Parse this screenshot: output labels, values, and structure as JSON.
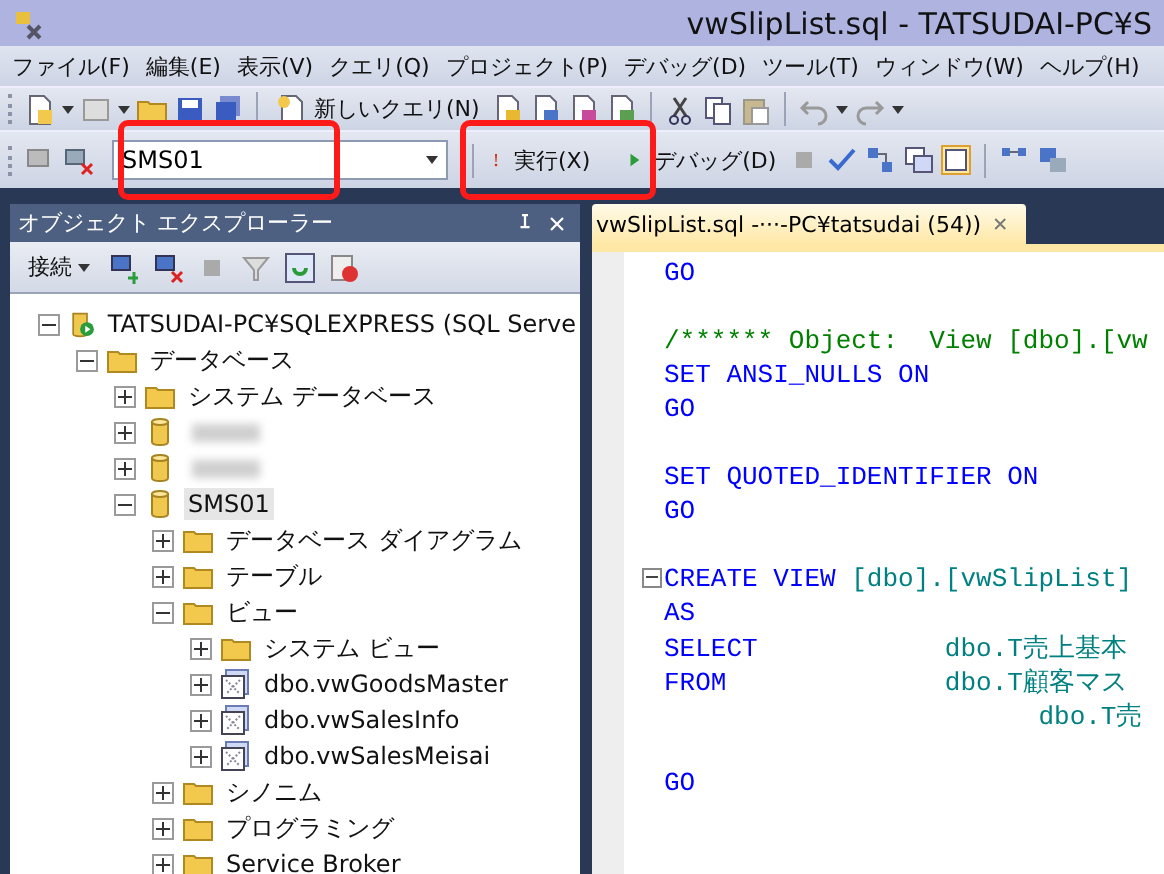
{
  "window": {
    "title": "vwSlipList.sql - TATSUDAI-PC¥S"
  },
  "menu": [
    "ファイル(F)",
    "編集(E)",
    "表示(V)",
    "クエリ(Q)",
    "プロジェクト(P)",
    "デバッグ(D)",
    "ツール(T)",
    "ウィンドウ(W)",
    "ヘルプ(H)"
  ],
  "toolbar": {
    "new_query": "新しいクエリ(N)",
    "database_combo": "SMS01",
    "execute": "実行(X)",
    "debug": "デバッグ(D)"
  },
  "object_explorer": {
    "title": "オブジェクト エクスプローラー",
    "connect": "接続",
    "tree": [
      {
        "kind": "server",
        "label": "TATSUDAI-PC¥SQLEXPRESS (SQL Serve",
        "expanded": true,
        "children": [
          {
            "kind": "folder",
            "label": "データベース",
            "expanded": true,
            "children": [
              {
                "kind": "folder",
                "label": "システム データベース",
                "expanded": false
              },
              {
                "kind": "database",
                "blurred": true,
                "expanded": false
              },
              {
                "kind": "database",
                "blurred": true,
                "expanded": false
              },
              {
                "kind": "database",
                "label": "SMS01",
                "expanded": true,
                "selected": true,
                "children": [
                  {
                    "kind": "folder",
                    "label": "データベース ダイアグラム",
                    "expanded": false
                  },
                  {
                    "kind": "folder",
                    "label": "テーブル",
                    "expanded": false
                  },
                  {
                    "kind": "folder",
                    "label": "ビュー",
                    "expanded": true,
                    "children": [
                      {
                        "kind": "folder",
                        "label": "システム ビュー",
                        "expanded": false
                      },
                      {
                        "kind": "view",
                        "label": "dbo.vwGoodsMaster",
                        "expanded": false
                      },
                      {
                        "kind": "view",
                        "label": "dbo.vwSalesInfo",
                        "expanded": false
                      },
                      {
                        "kind": "view",
                        "label": "dbo.vwSalesMeisai",
                        "expanded": false
                      }
                    ]
                  },
                  {
                    "kind": "folder",
                    "label": "シノニム",
                    "expanded": false
                  },
                  {
                    "kind": "folder",
                    "label": "プログラミング",
                    "expanded": false
                  },
                  {
                    "kind": "folder",
                    "label": "Service Broker",
                    "expanded": false
                  }
                ]
              }
            ]
          }
        ]
      }
    ]
  },
  "editor": {
    "tab": "vwSlipList.sql -···-PC¥tatsudai (54))",
    "lines": [
      {
        "space_before": false,
        "foldable": false,
        "segments": [
          {
            "kind": "keyword",
            "text": "GO"
          }
        ]
      },
      {
        "space_before": true,
        "foldable": false,
        "segments": [
          {
            "kind": "comment",
            "text": "/****** Object:  View [dbo].[vw"
          }
        ]
      },
      {
        "space_before": false,
        "foldable": false,
        "segments": [
          {
            "kind": "keyword",
            "text": "SET ANSI_NULLS ON"
          }
        ]
      },
      {
        "space_before": false,
        "foldable": false,
        "segments": [
          {
            "kind": "keyword",
            "text": "GO"
          }
        ]
      },
      {
        "space_before": true,
        "foldable": false,
        "segments": [
          {
            "kind": "keyword",
            "text": "SET QUOTED_IDENTIFIER ON"
          }
        ]
      },
      {
        "space_before": false,
        "foldable": false,
        "segments": [
          {
            "kind": "keyword",
            "text": "GO"
          }
        ]
      },
      {
        "space_before": true,
        "foldable": true,
        "segments": [
          {
            "kind": "keyword",
            "text": "CREATE VIEW "
          },
          {
            "kind": "identifier",
            "text": "[dbo].[vwSlipList]"
          }
        ]
      },
      {
        "space_before": false,
        "foldable": false,
        "segments": [
          {
            "kind": "keyword",
            "text": "AS"
          }
        ]
      },
      {
        "space_before": false,
        "foldable": false,
        "segments": [
          {
            "kind": "keyword",
            "text": "SELECT"
          },
          {
            "kind": "identifier",
            "text": "            dbo.T売上基本"
          }
        ]
      },
      {
        "space_before": false,
        "foldable": false,
        "segments": [
          {
            "kind": "keyword",
            "text": "FROM"
          },
          {
            "kind": "identifier",
            "text": "              dbo.T顧客マス"
          }
        ]
      },
      {
        "space_before": false,
        "foldable": false,
        "segments": [
          {
            "kind": "identifier",
            "text": "                        dbo.T売"
          }
        ]
      },
      {
        "space_before": true,
        "foldable": false,
        "segments": [
          {
            "kind": "keyword",
            "text": "GO"
          }
        ]
      }
    ]
  }
}
